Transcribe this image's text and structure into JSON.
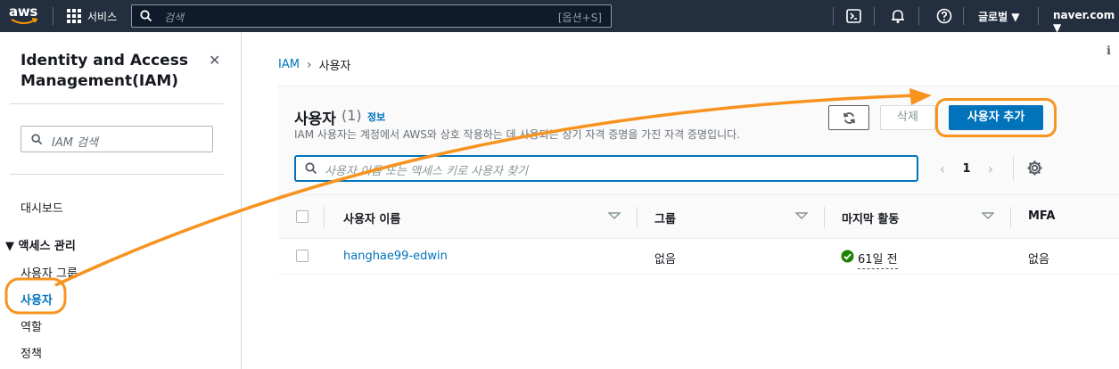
{
  "topnav": {
    "logo_text": "aws",
    "services_label": "서비스",
    "search_placeholder": "검색",
    "search_shortcut": "[옵션+S]",
    "region_label": "글로벌 ▼",
    "account_label": "naver.com ▼"
  },
  "sidebar": {
    "title": "Identity and Access Management(IAM)",
    "search_placeholder": "IAM 검색",
    "dashboard": "대시보드",
    "section_label": "▼ 액세스 관리",
    "items": [
      "사용자 그룹",
      "사용자",
      "역할",
      "정책"
    ],
    "active_item": "사용자"
  },
  "breadcrumb": {
    "root": "IAM",
    "current": "사용자"
  },
  "panel": {
    "title": "사용자",
    "count": "(1)",
    "info_link": "정보",
    "description": "IAM 사용자는 계정에서 AWS와 상호 작용하는 데 사용되는 장기 자격 증명을 가진 자격 증명입니다.",
    "delete_label": "삭제",
    "add_label": "사용자 추가",
    "search_placeholder": "사용자 이름 또는 액세스 키로 사용자 찾기",
    "page": "1"
  },
  "table": {
    "columns": [
      "사용자 이름",
      "그룹",
      "마지막 활동",
      "MFA"
    ],
    "rows": [
      {
        "user_name": "hanghae99-edwin",
        "group": "없음",
        "last_activity": "61일 전",
        "mfa": "없음"
      }
    ]
  },
  "colors": {
    "nav_bg": "#232f3e",
    "accent": "#0073bb",
    "highlight": "#f7931e",
    "success": "#1d8102"
  }
}
